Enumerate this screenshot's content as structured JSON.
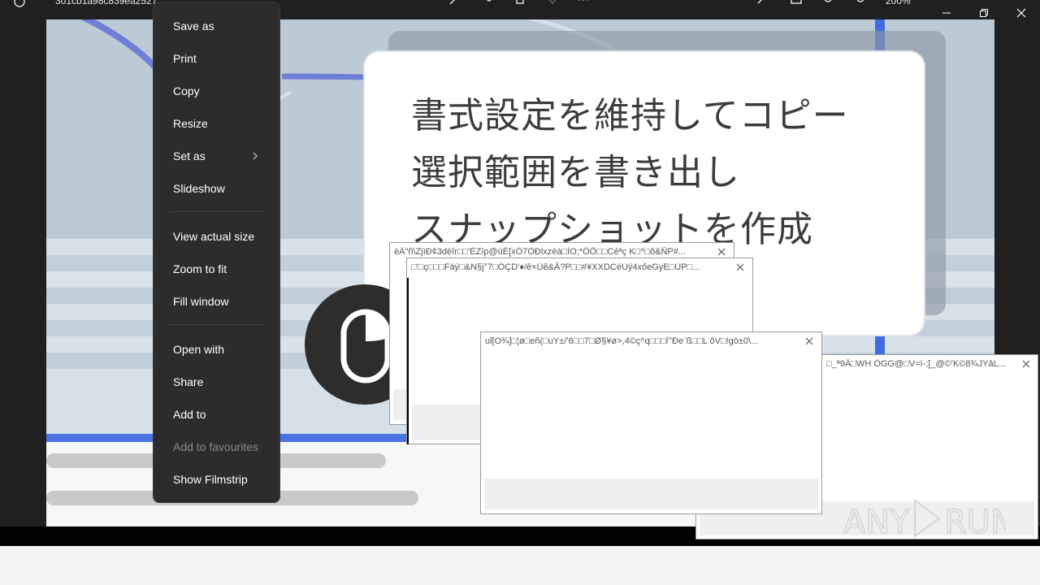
{
  "window": {
    "file_title": "301cb1a98c839ea2527...",
    "zoom_level": "200%"
  },
  "image_text": {
    "line1": "書式設定を維持してコピー",
    "line2": "選択範囲を書き出し",
    "line3": "スナップショットを作成"
  },
  "context_menu": {
    "items": [
      {
        "label": "Save as"
      },
      {
        "label": "Print"
      },
      {
        "label": "Copy"
      },
      {
        "label": "Resize"
      },
      {
        "label": "Set as"
      },
      {
        "label": "Slideshow"
      },
      {
        "label": "View actual size"
      },
      {
        "label": "Zoom to fit"
      },
      {
        "label": "Fill window"
      },
      {
        "label": "Open with"
      },
      {
        "label": "Share"
      },
      {
        "label": "Add to"
      },
      {
        "label": "Add to favourites"
      },
      {
        "label": "Show Filmstrip"
      }
    ]
  },
  "dialogs": [
    {
      "title": "èÄ\"ñ\\ZjìÐ¢3déîr□□'ÉZîp@úÉ[xÖ7ŐÐlxzèá□ÍO;*ÔÕ□□Céªç K□^□ô&ÑP#..."
    },
    {
      "title": "□'□ç□□□Fäý□&N§j°7□ÖÇD'♦/ê×Ûê&Ã?P□□#¥XXDCéÚý4xőeGyE□ÙP□..."
    },
    {
      "title": "ul[O¾]□¦ø□eñ(□uY±/'6□□7□Ø§¥ø>,4©ç^q□□□Ì°Ðe¨ß□□L ôV□!gò±0\\..."
    },
    {
      "title": "□_ª9Â□WH  ÔGG@□V=ï-;[_@©'K©8¾JYâL..."
    }
  ],
  "watermark": {
    "text": "ANY RUN"
  },
  "colors": {
    "titlebar": "#202020",
    "menu_bg": "#2c2c2c",
    "accent_blue": "#4b73e2"
  }
}
